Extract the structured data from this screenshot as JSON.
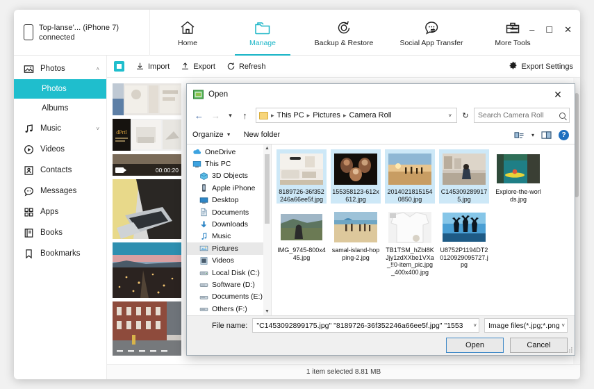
{
  "app": {
    "device": {
      "line1": "Top-lanse'... (iPhone 7)",
      "line2": "connected",
      "icon": "phone-icon"
    },
    "nav": [
      {
        "label": "Home",
        "icon": "home-icon",
        "active": false
      },
      {
        "label": "Manage",
        "icon": "folder-manage-icon",
        "active": true
      },
      {
        "label": "Backup & Restore",
        "icon": "backup-restore-icon",
        "active": false
      },
      {
        "label": "Social App Transfer",
        "icon": "chat-transfer-icon",
        "active": false
      },
      {
        "label": "More Tools",
        "icon": "toolbox-icon",
        "active": false
      }
    ],
    "window_controls": {
      "menu": "☰",
      "minimize": "–",
      "maximize": "☐",
      "close": "✕"
    },
    "sidebar": [
      {
        "label": "Photos",
        "icon": "photos-icon",
        "chevron": "˄",
        "expanded": true
      },
      {
        "label": "Photos",
        "sub": true,
        "selected": true
      },
      {
        "label": "Albums",
        "sub": true,
        "selected": false
      },
      {
        "label": "Music",
        "icon": "music-icon",
        "chevron": "˅",
        "expanded": false
      },
      {
        "label": "Videos",
        "icon": "videos-icon"
      },
      {
        "label": "Contacts",
        "icon": "contacts-icon"
      },
      {
        "label": "Messages",
        "icon": "messages-icon"
      },
      {
        "label": "Apps",
        "icon": "apps-icon"
      },
      {
        "label": "Books",
        "icon": "books-icon"
      },
      {
        "label": "Bookmarks",
        "icon": "bookmarks-icon"
      }
    ],
    "toolbar": {
      "select_all_icon": "select-all-icon",
      "import": "Import",
      "export": "Export",
      "refresh": "Refresh",
      "export_settings": "Export Settings",
      "gear_icon": "gear-icon"
    },
    "gallery": [
      {
        "name": "collage-thumbnail",
        "kind": "image"
      },
      {
        "name": "interior-collage-thumbnail",
        "kind": "image"
      },
      {
        "name": "video-thumbnail",
        "kind": "video",
        "duration": "00:00:20"
      },
      {
        "name": "laptop-typing-thumbnail",
        "kind": "image"
      },
      {
        "name": "city-sunset-thumbnail",
        "kind": "image"
      },
      {
        "name": "street-buildings-thumbnail",
        "kind": "image"
      }
    ]
  },
  "dialog": {
    "title": "Open",
    "close_icon": "close-icon",
    "nav": {
      "back_icon": "back-arrow-icon",
      "forward_icon": "forward-arrow-icon",
      "recent_icon": "chevron-down-icon",
      "up_icon": "up-arrow-icon",
      "breadcrumbs": [
        "This PC",
        "Pictures",
        "Camera Roll"
      ],
      "breadcrumb_dropdown": "˅",
      "refresh_icon": "refresh-icon",
      "search_placeholder": "Search Camera Roll",
      "search_icon": "search-icon"
    },
    "commands": {
      "organize": "Organize",
      "new_folder": "New folder",
      "view_icon": "view-mode-icon",
      "view_dropdown": "▾",
      "preview_pane_icon": "preview-pane-icon",
      "help_icon": "help-icon",
      "help_glyph": "?"
    },
    "tree": [
      {
        "label": "OneDrive",
        "icon": "onedrive-icon",
        "indent": false,
        "selected": false
      },
      {
        "label": "This PC",
        "icon": "this-pc-icon",
        "indent": false,
        "selected": false
      },
      {
        "label": "3D Objects",
        "icon": "3d-objects-icon",
        "indent": true,
        "selected": false
      },
      {
        "label": "Apple iPhone",
        "icon": "apple-iphone-icon",
        "indent": true,
        "selected": false
      },
      {
        "label": "Desktop",
        "icon": "desktop-icon",
        "indent": true,
        "selected": false
      },
      {
        "label": "Documents",
        "icon": "documents-icon",
        "indent": true,
        "selected": false
      },
      {
        "label": "Downloads",
        "icon": "downloads-icon",
        "indent": true,
        "selected": false
      },
      {
        "label": "Music",
        "icon": "music-folder-icon",
        "indent": true,
        "selected": false
      },
      {
        "label": "Pictures",
        "icon": "pictures-icon",
        "indent": true,
        "selected": true
      },
      {
        "label": "Videos",
        "icon": "videos-folder-icon",
        "indent": true,
        "selected": false
      },
      {
        "label": "Local Disk (C:)",
        "icon": "local-disk-icon",
        "indent": true,
        "selected": false
      },
      {
        "label": "Software (D:)",
        "icon": "drive-icon",
        "indent": true,
        "selected": false
      },
      {
        "label": "Documents (E:)",
        "icon": "drive-icon",
        "indent": true,
        "selected": false
      },
      {
        "label": "Others (F:)",
        "icon": "drive-icon",
        "indent": true,
        "selected": false
      }
    ],
    "files_row1": [
      {
        "name": "8189726-36f352246a66ee5f.jpg",
        "selected": true,
        "thumb": "living-room"
      },
      {
        "name": "155358123-612x612.jpg",
        "selected": true,
        "thumb": "family-dark"
      },
      {
        "name": "20140218151540850.jpg",
        "selected": true,
        "thumb": "beach-sunset"
      },
      {
        "name": "C1453092899175.jpg",
        "selected": true,
        "thumb": "woman-sitting"
      },
      {
        "name": "Explore-the-worlds.jpg",
        "selected": false,
        "thumb": "kayak"
      }
    ],
    "files_row2": [
      {
        "name": "IMG_9745-800x445.jpg",
        "selected": false,
        "thumb": "hill-view"
      },
      {
        "name": "samal-island-hopping-2.jpg",
        "selected": false,
        "thumb": "beach-people"
      },
      {
        "name": "TB1TSM_hZbI8KJjy1zdXXbe1VXa_!!0-item_pic.jpg_400x400.jpg",
        "selected": false,
        "thumb": "white-shirt"
      },
      {
        "name": "U8752P1194DT20120929095727.jpg",
        "selected": false,
        "thumb": "jumping-silhouette"
      }
    ],
    "footer": {
      "file_name_label": "File name:",
      "file_name_value": "\"C1453092899175.jpg\" \"8189726-36f352246a66ee5f.jpg\" \"1553",
      "file_name_dropdown": "˅",
      "filter_value": "Image files(*.jpg;*.png;*.bmp;*.",
      "filter_dropdown": "˅",
      "open_button": "Open",
      "cancel_button": "Cancel"
    }
  },
  "status": {
    "text": "1 item selected 8.81 MB"
  },
  "colors": {
    "accent": "#1fbecd",
    "accent_text": "#17b4c6",
    "selection": "#cde8f7",
    "link": "#2b579a"
  }
}
